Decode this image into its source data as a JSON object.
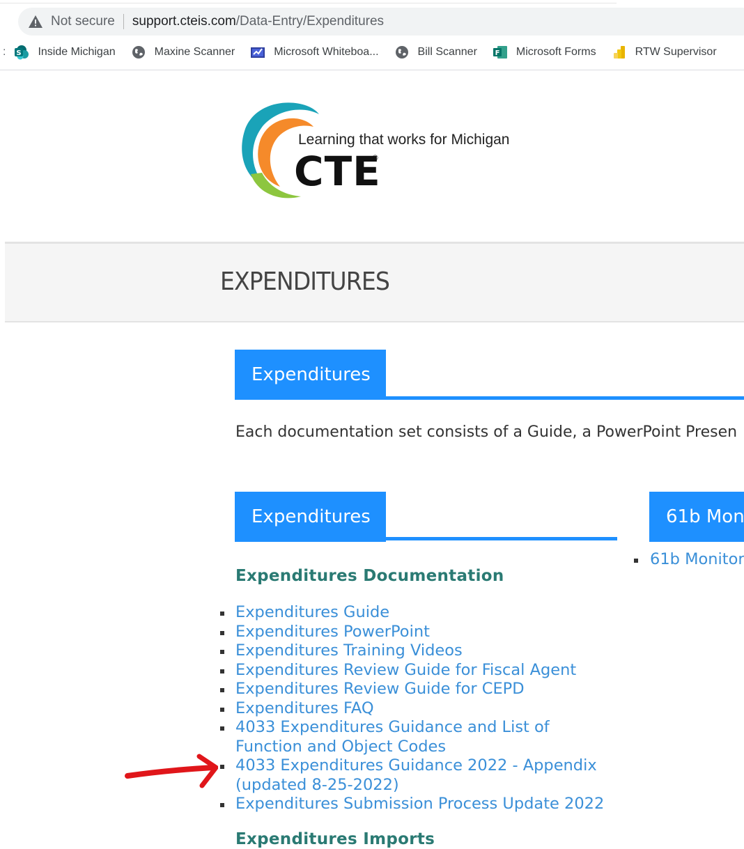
{
  "browser": {
    "security_label": "Not secure",
    "url_host": "support.cteis.com",
    "url_path": "/Data-Entry/Expenditures",
    "bookmarks_overflow": ":",
    "bookmarks": [
      {
        "label": "Inside Michigan",
        "icon": "sharepoint-icon"
      },
      {
        "label": "Maxine Scanner",
        "icon": "globe-icon"
      },
      {
        "label": "Microsoft Whiteboa...",
        "icon": "whiteboard-icon"
      },
      {
        "label": "Bill Scanner",
        "icon": "globe-icon"
      },
      {
        "label": "Microsoft Forms",
        "icon": "forms-icon"
      },
      {
        "label": "RTW Supervisor",
        "icon": "power-bi-icon"
      }
    ]
  },
  "logo": {
    "tagline": "Learning that works for Michigan",
    "wordmark": "CTE",
    "registered": "®"
  },
  "page": {
    "title": "EXPENDITURES",
    "main_tab": "Expenditures",
    "intro": "Each documentation set consists of a Guide, a PowerPoint Presen"
  },
  "left_panel": {
    "tab": "Expenditures",
    "documentation_heading": "Expenditures Documentation",
    "documentation_links": [
      "Expenditures Guide",
      "Expenditures PowerPoint",
      "Expenditures Training Videos",
      "Expenditures Review Guide for Fiscal Agent",
      "Expenditures Review Guide for CEPD",
      "Expenditures FAQ",
      "4033 Expenditures Guidance and List of Function and Object Codes",
      "4033 Expenditures Guidance 2022 - Appendix (updated 8-25-2022)",
      "Expenditures Submission Process Update 2022"
    ],
    "imports_heading": "Expenditures Imports"
  },
  "right_panel": {
    "tab": "61b Mon",
    "links": [
      "61b Monitor"
    ]
  },
  "colors": {
    "accent": "#1e90ff",
    "link": "#3a8fd8",
    "heading": "#2a7a73",
    "annotation": "#e0161a"
  }
}
